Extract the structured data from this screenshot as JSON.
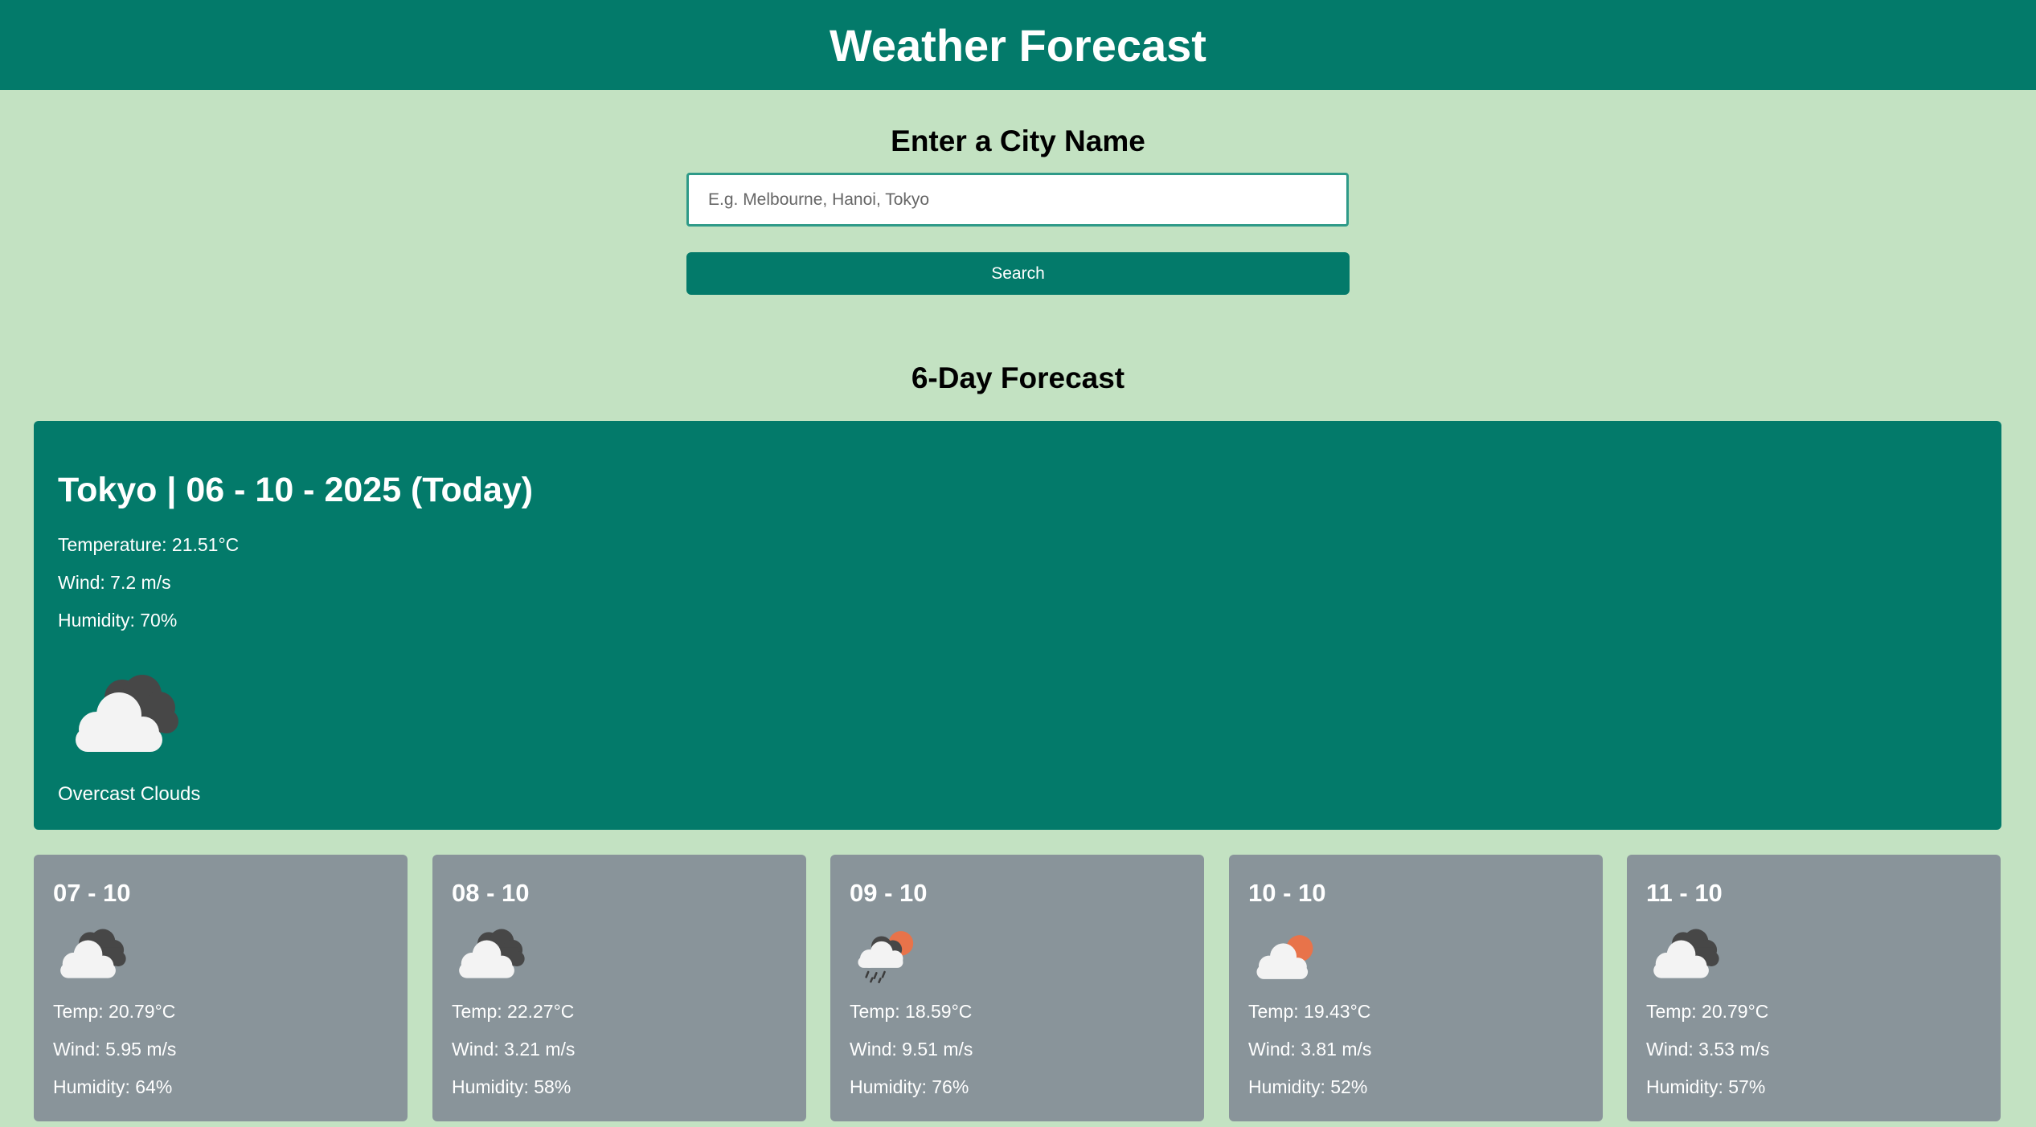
{
  "header": {
    "title": "Weather Forecast"
  },
  "search": {
    "heading": "Enter a City Name",
    "placeholder": "E.g. Melbourne, Hanoi, Tokyo",
    "button_label": "Search"
  },
  "forecast": {
    "heading": "6-Day Forecast",
    "today": {
      "title": "Tokyo | 06 - 10 - 2025 (Today)",
      "temperature": "Temperature: 21.51°C",
      "wind": "Wind: 7.2 m/s",
      "humidity": "Humidity: 70%",
      "icon": "overcast-clouds-icon",
      "description": "Overcast Clouds"
    },
    "days": [
      {
        "date": "07 - 10",
        "icon": "overcast-clouds-icon",
        "temp": "Temp: 20.79°C",
        "wind": "Wind: 5.95 m/s",
        "humidity": "Humidity: 64%"
      },
      {
        "date": "08 - 10",
        "icon": "overcast-clouds-icon",
        "temp": "Temp: 22.27°C",
        "wind": "Wind: 3.21 m/s",
        "humidity": "Humidity: 58%"
      },
      {
        "date": "09 - 10",
        "icon": "rain-sun-icon",
        "temp": "Temp: 18.59°C",
        "wind": "Wind: 9.51 m/s",
        "humidity": "Humidity: 76%"
      },
      {
        "date": "10 - 10",
        "icon": "partly-cloudy-icon",
        "temp": "Temp: 19.43°C",
        "wind": "Wind: 3.81 m/s",
        "humidity": "Humidity: 52%"
      },
      {
        "date": "11 - 10",
        "icon": "overcast-clouds-icon",
        "temp": "Temp: 20.79°C",
        "wind": "Wind: 3.53 m/s",
        "humidity": "Humidity: 57%"
      }
    ]
  },
  "colors": {
    "background": "#c3e2c2",
    "primary": "#037a6a",
    "card": "#89949a",
    "sun": "#e8734a"
  }
}
